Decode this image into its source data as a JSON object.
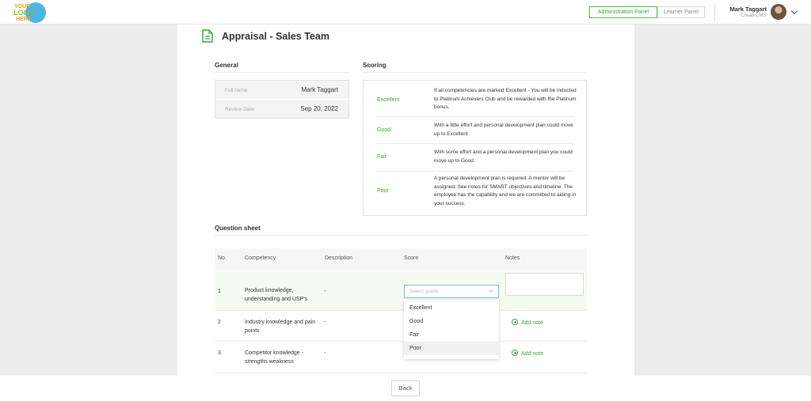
{
  "header": {
    "logo": {
      "line1": "YOUR",
      "line2": "LOGO",
      "line3": "HERE"
    },
    "admin_panel_label": "Administration Panel",
    "learner_panel_label": "Learner Panel",
    "user_name": "Mark Taggart",
    "user_org": "CreateLMS"
  },
  "page": {
    "title": "Appraisal - Sales Team"
  },
  "general": {
    "title": "General",
    "full_name_label": "Full name",
    "full_name_value": "Mark Taggart",
    "review_date_label": "Review Date",
    "review_date_value": "Sep 20, 2022"
  },
  "scoring": {
    "title": "Scoring",
    "rows": [
      {
        "name": "Excellent",
        "desc": "If all competencies are marked Excellent - You will be inducted to Platinum Achievers Club and be rewarded with the Platinum bonus."
      },
      {
        "name": "Good",
        "desc": "With a little effort and personal development plan could move up to Excellent"
      },
      {
        "name": "Fair",
        "desc": "With some effort and a personal development plan you could move up to Good."
      },
      {
        "name": "Poor",
        "desc": "A personal development plan is required. A mentor will be assigned. See notes for SMART objectives and timeline. The employee has the capability and we are committed to aiding in your success."
      }
    ]
  },
  "questions": {
    "title": "Question sheet",
    "columns": {
      "no": "No.",
      "competency": "Competency",
      "description": "Description",
      "score": "Score",
      "notes": "Notes"
    },
    "rows": [
      {
        "no": "1",
        "competency": "Product knowledge, understanding and USP's",
        "description": "-"
      },
      {
        "no": "2",
        "competency": "Industry knowledge and pain points",
        "description": "-"
      },
      {
        "no": "3",
        "competency": "Competitor knowledge - strengths weakness",
        "description": "-"
      }
    ],
    "select_placeholder": "Select grade",
    "grade_options": [
      "Excellent",
      "Good",
      "Fair",
      "Poor"
    ],
    "add_note_label": "Add note"
  },
  "footer": {
    "back_label": "Back"
  },
  "colors": {
    "accent_green": "#3aa53a",
    "focus_blue": "#78b9e8"
  }
}
